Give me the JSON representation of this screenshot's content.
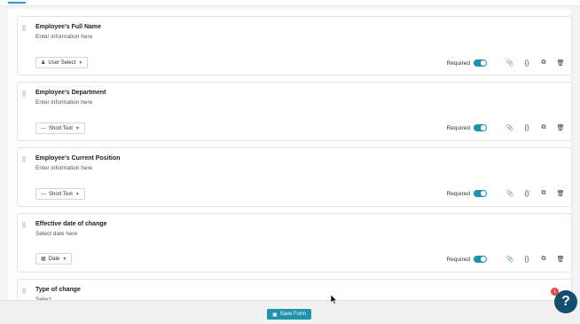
{
  "questions": [
    {
      "title": "Employee's Full Name",
      "subtitle": "Enter information here",
      "type_label": "User Select",
      "type_icon": "user-icon",
      "required_label": "Required",
      "required": true
    },
    {
      "title": "Employee's Department",
      "subtitle": "Enter information here",
      "type_label": "Short Text",
      "type_icon": "short-text-icon",
      "required_label": "Required",
      "required": true
    },
    {
      "title": "Employee's Current Position",
      "subtitle": "Enter information here",
      "type_label": "Short Text",
      "type_icon": "short-text-icon",
      "required_label": "Required",
      "required": true
    },
    {
      "title": "Effective date of change",
      "subtitle": "Select date here",
      "type_label": "Date",
      "type_icon": "calendar-icon",
      "required_label": "Required",
      "required": true
    },
    {
      "title": "Type of change",
      "subtitle": "Select..."
    }
  ],
  "footer": {
    "save_label": "Save Form"
  },
  "help": {
    "label": "?",
    "badge": "1"
  },
  "colors": {
    "accent": "#1f93a8",
    "help": "#134e6f",
    "badge": "#e5474b"
  }
}
